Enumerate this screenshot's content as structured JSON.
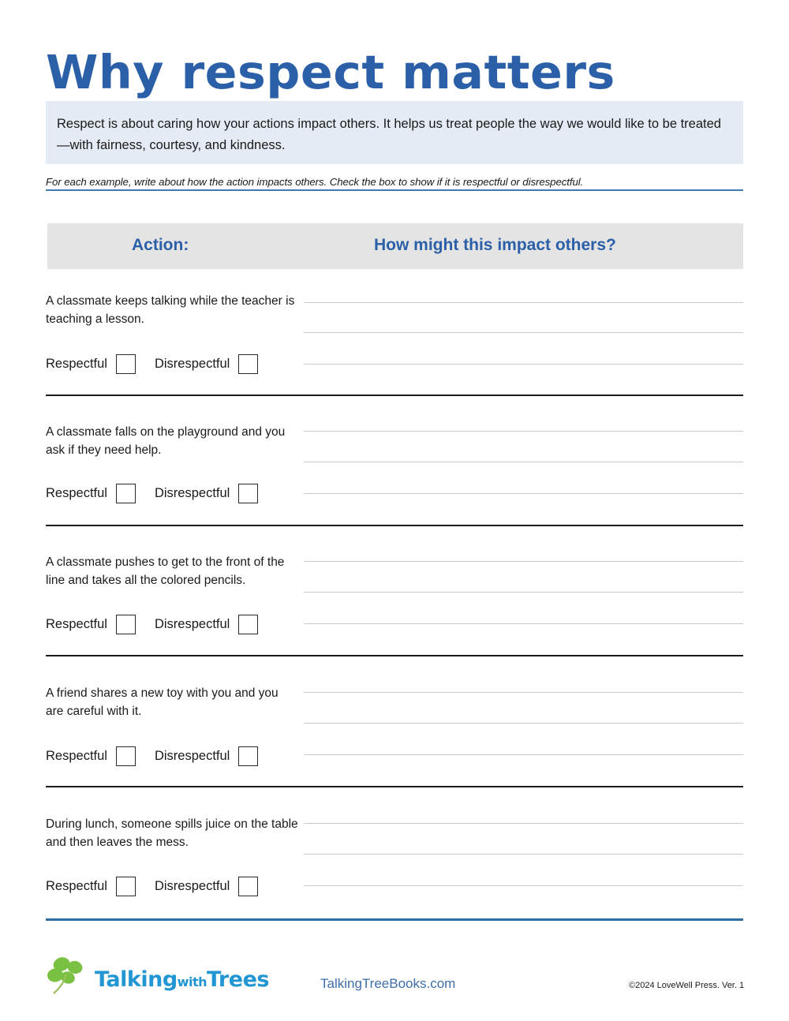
{
  "title": "Why respect matters",
  "intro": "Respect is about caring how your actions impact others. It helps us treat people the way we would like to be treated—with fairness, courtesy, and kindness.",
  "instruction": "For each example, write about how the action impacts others. Check the box to show if it is respectful or disrespectful.",
  "table": {
    "header": {
      "action": "Action:",
      "impact": "How might this impact others?"
    },
    "choice_labels": {
      "respectful": "Respectful",
      "disrespectful": "Disrespectful"
    },
    "rows": [
      {
        "action": "A classmate keeps talking while the teacher is teaching a lesson."
      },
      {
        "action": "A classmate falls on the playground and you ask if they need help."
      },
      {
        "action": "A classmate pushes to get to the front of the line and takes all the colored pencils."
      },
      {
        "action": "A friend shares a new toy with you and you are careful with it."
      },
      {
        "action": "During lunch, someone spills juice on the table and then leaves the mess."
      }
    ]
  },
  "footer": {
    "logo_talking": "Talking",
    "logo_with": "with",
    "logo_trees": "Trees",
    "url": "TalkingTreeBooks.com",
    "copyright": "©2024 LoveWell Press.  Ver. 1"
  },
  "colors": {
    "title_blue": "#2B5FA8",
    "intro_background": "#E4EBF4",
    "header_background": "#E4E4E4",
    "rule_blue": "#3E7CB1",
    "bottom_rule_blue": "#2E6DA4",
    "logo_blue": "#2196D3",
    "logo_green": "#7AC143",
    "url_blue": "#3E6EA8",
    "answer_line_gray": "#C9C9C9",
    "separator_dark": "#1C1C1C"
  }
}
